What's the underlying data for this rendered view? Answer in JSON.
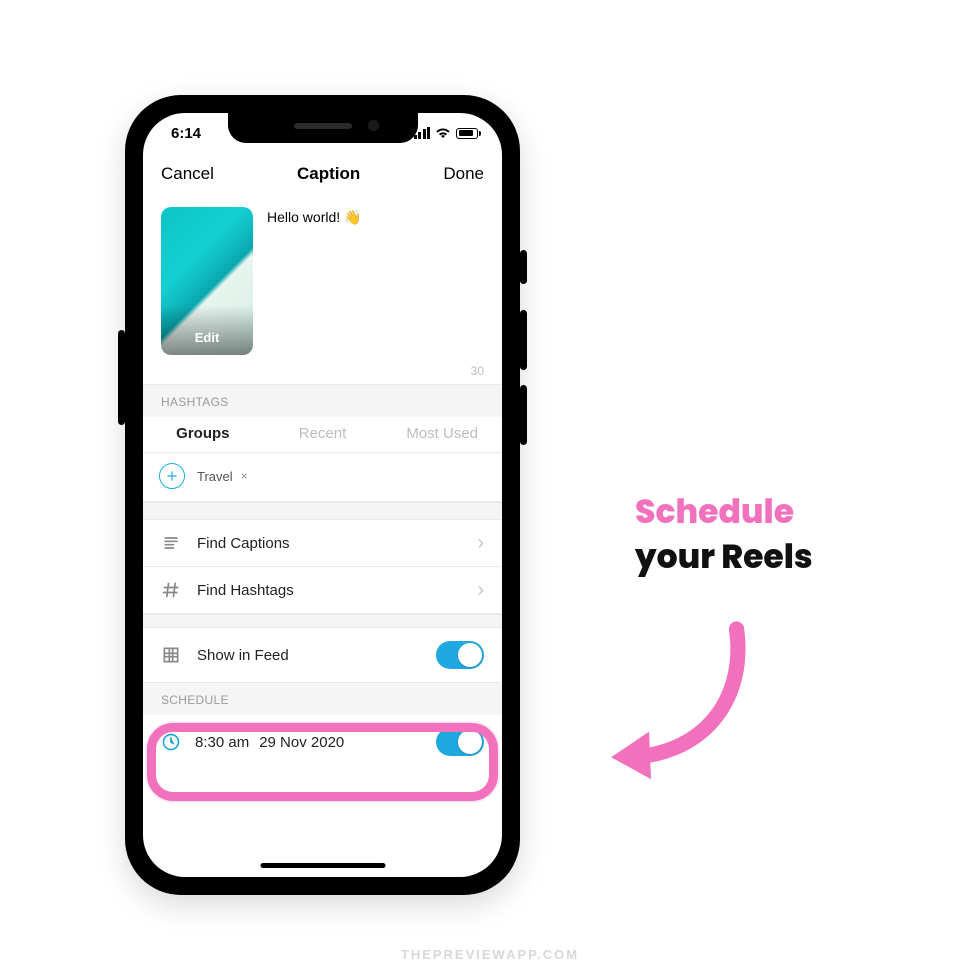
{
  "status": {
    "time": "6:14"
  },
  "nav": {
    "cancel": "Cancel",
    "title": "Caption",
    "done": "Done"
  },
  "caption": {
    "text": "Hello world! 👋",
    "edit": "Edit",
    "count": "30"
  },
  "sections": {
    "hashtags": "HASHTAGS",
    "schedule": "SCHEDULE"
  },
  "tabs": {
    "groups": "Groups",
    "recent": "Recent",
    "most_used": "Most Used"
  },
  "tag": {
    "name": "Travel",
    "remove": "×"
  },
  "rows": {
    "find_captions": "Find Captions",
    "find_hashtags": "Find Hashtags",
    "show_in_feed": "Show in Feed"
  },
  "schedule": {
    "time": "8:30 am",
    "date": "29 Nov 2020"
  },
  "annotation": {
    "line1": "Schedule",
    "line2": "your Reels"
  },
  "watermark": "THEPREVIEWAPP.COM",
  "colors": {
    "accent": "#1fa9e0",
    "pink": "#f171bd"
  }
}
